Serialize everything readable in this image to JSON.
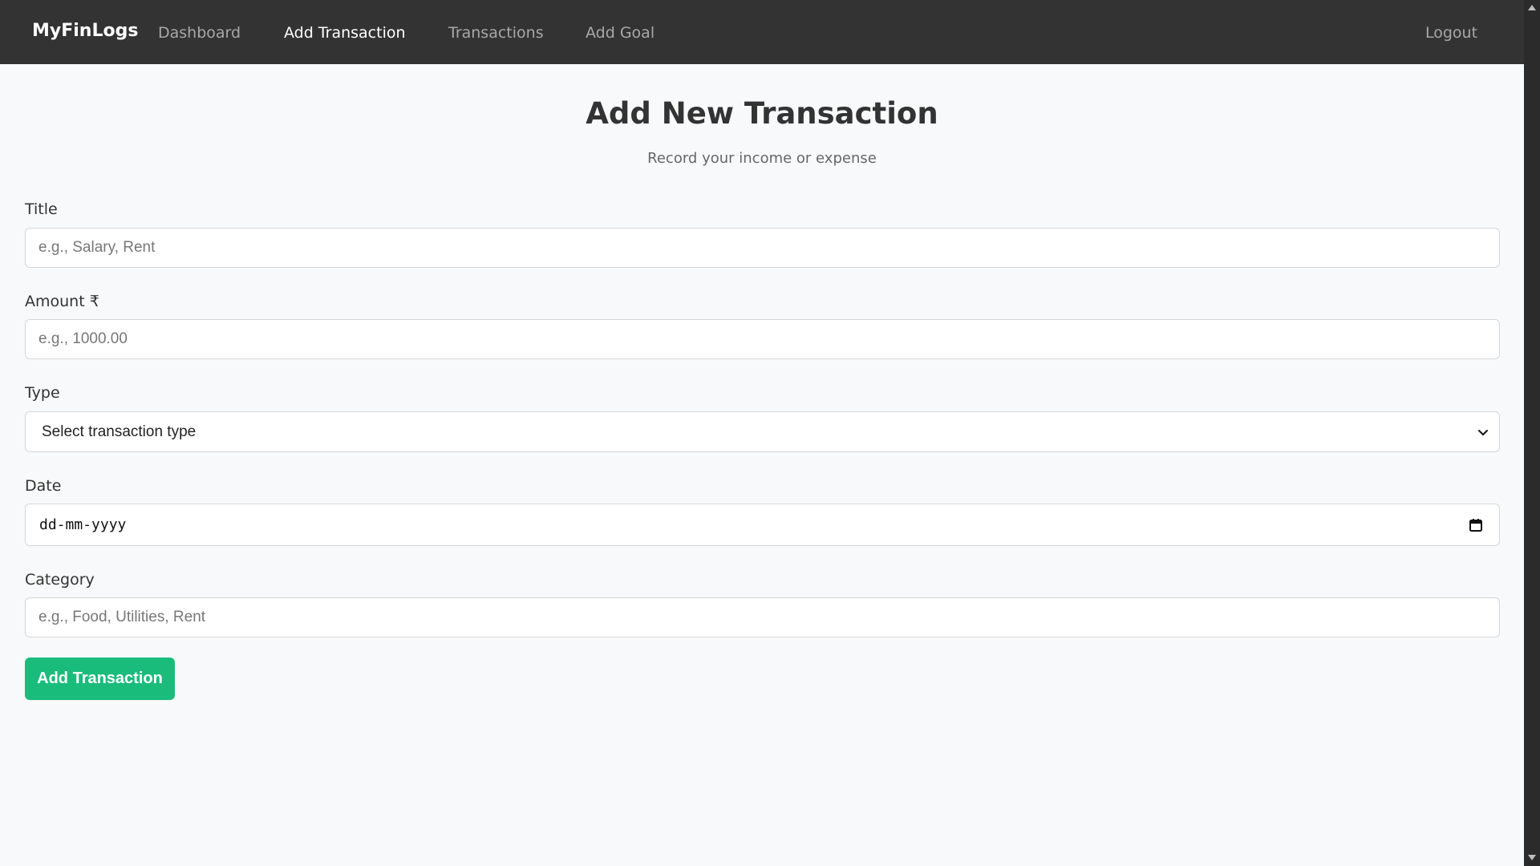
{
  "navbar": {
    "brand": "MyFinLogs",
    "links": [
      {
        "label": "Dashboard",
        "active": false
      },
      {
        "label": "Add Transaction",
        "active": true
      },
      {
        "label": "Transactions",
        "active": false
      },
      {
        "label": "Add Goal",
        "active": false
      }
    ],
    "logout_label": "Logout"
  },
  "page": {
    "title": "Add New Transaction",
    "subtitle": "Record your income or expense"
  },
  "form": {
    "title": {
      "label": "Title",
      "placeholder": "e.g., Salary, Rent",
      "value": ""
    },
    "amount": {
      "label": "Amount ₹",
      "placeholder": "e.g., 1000.00",
      "value": ""
    },
    "type": {
      "label": "Type",
      "selected": "Select transaction type"
    },
    "date": {
      "label": "Date",
      "display": "dd-mm-yyyy"
    },
    "category": {
      "label": "Category",
      "placeholder": "e.g., Food, Utilities, Rent",
      "value": ""
    },
    "submit_label": "Add Transaction"
  },
  "colors": {
    "navbar_bg": "#333333",
    "page_bg": "#f8f9fa",
    "accent": "#1abc7c",
    "nav_inactive": "#a8a8a8",
    "nav_active": "#ffffff"
  },
  "icons": {
    "type_select": "chevron-down-icon",
    "date_picker": "calendar-icon",
    "scroll_up": "triangle-up-icon",
    "scroll_down": "triangle-down-icon"
  }
}
